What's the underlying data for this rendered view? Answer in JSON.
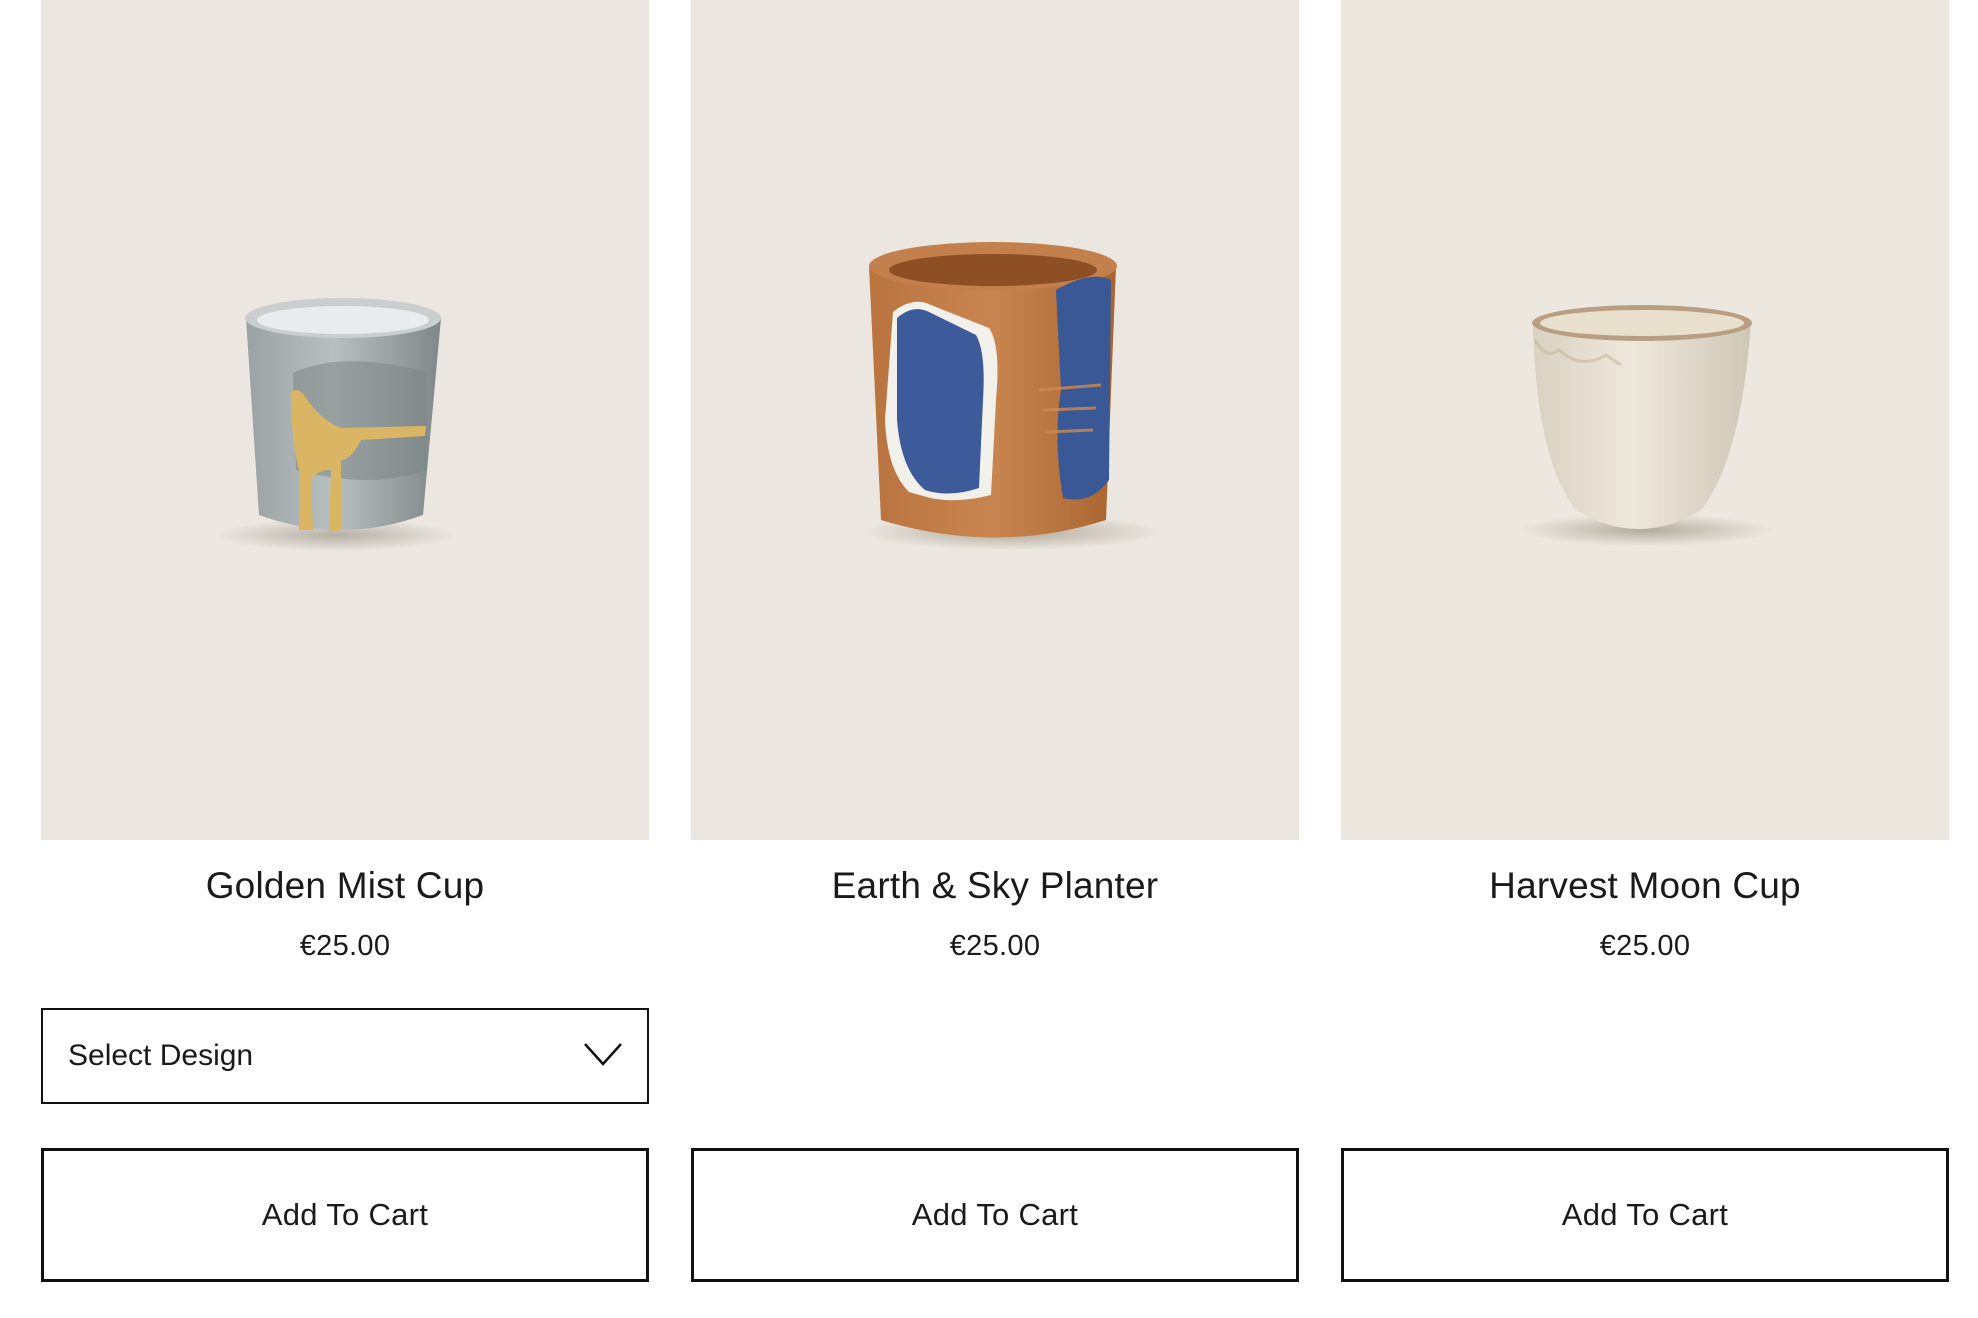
{
  "products": [
    {
      "name": "Golden Mist Cup",
      "price": "€25.00",
      "image_alt": "gray glazed cup with gold drip",
      "select": {
        "label": "Select Design",
        "icon": "chevron-down-icon"
      },
      "button_label": "Add To Cart"
    },
    {
      "name": "Earth & Sky Planter",
      "price": "€25.00",
      "image_alt": "terracotta planter with blue and white brush strokes",
      "button_label": "Add To Cart"
    },
    {
      "name": "Harvest Moon Cup",
      "price": "€25.00",
      "image_alt": "cream speckled ceramic cup",
      "button_label": "Add To Cart"
    }
  ],
  "colors": {
    "photo_background": "#ebe6df",
    "border": "#111111",
    "text": "#1a1a1a"
  }
}
